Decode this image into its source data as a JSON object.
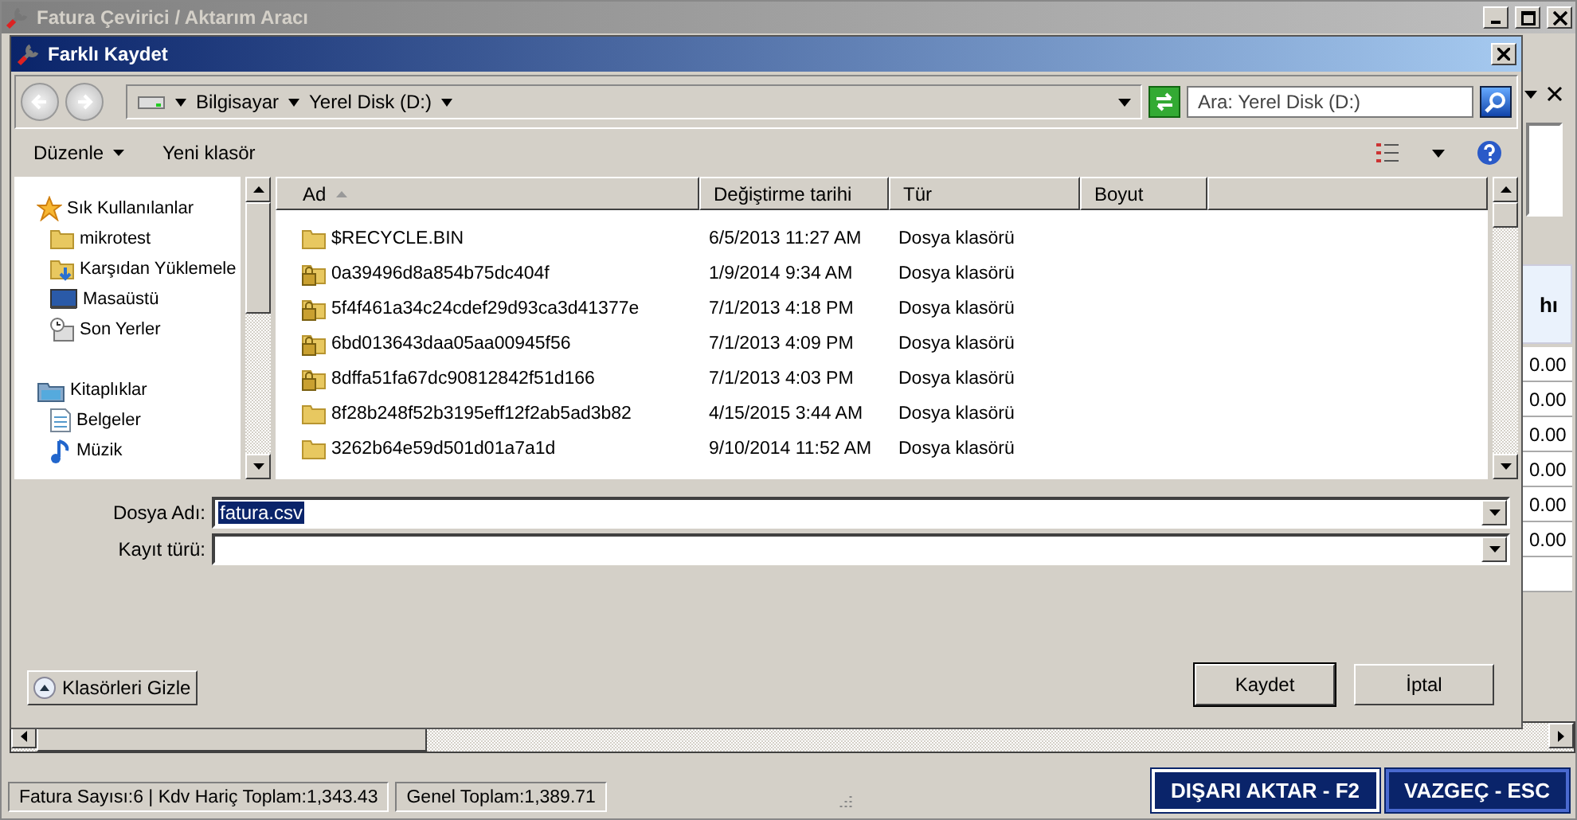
{
  "app": {
    "title": "Fatura Çevirici / Aktarım Aracı",
    "table_header_fragment": "hı",
    "table_cells": [
      "0.00",
      "0.00",
      "0.00",
      "0.00",
      "0.00",
      "0.00"
    ],
    "status_bar": [
      "Fatura Sayısı:6 | Kdv Hariç Toplam:1,343.43",
      "Genel Toplam:1,389.71"
    ],
    "buttons": [
      "DIŞARI AKTAR - F2",
      "VAZGEÇ - ESC"
    ]
  },
  "dialog": {
    "title": "Farklı Kaydet",
    "breadcrumb": [
      "Bilgisayar",
      "Yerel Disk (D:)"
    ],
    "search": {
      "placeholder": "Ara: Yerel Disk (D:)"
    },
    "toolbar": [
      "Düzenle",
      "Yeni klasör"
    ],
    "nav_tree": [
      {
        "label": "Sık Kullanılanlar",
        "kind": "favorites",
        "children": [
          {
            "label": "mikrotest",
            "kind": "folder"
          },
          {
            "label": "Karşıdan Yüklemele",
            "kind": "downloads"
          },
          {
            "label": "Masaüstü",
            "kind": "desktop"
          },
          {
            "label": "Son Yerler",
            "kind": "recent"
          }
        ]
      },
      {
        "label": "Kitaplıklar",
        "kind": "libraries",
        "children": [
          {
            "label": "Belgeler",
            "kind": "documents"
          },
          {
            "label": "Müzik",
            "kind": "music"
          }
        ]
      }
    ],
    "columns": [
      "Ad",
      "Değiştirme tarihi",
      "Tür",
      "Boyut"
    ],
    "files": [
      {
        "name": "$RECYCLE.BIN",
        "modified": "6/5/2013 11:27 AM",
        "type": "Dosya klasörü",
        "locked": false
      },
      {
        "name": "0a39496d8a854b75dc404f",
        "modified": "1/9/2014 9:34 AM",
        "type": "Dosya klasörü",
        "locked": true
      },
      {
        "name": "5f4f461a34c24cdef29d93ca3d41377e",
        "modified": "7/1/2013 4:18 PM",
        "type": "Dosya klasörü",
        "locked": true
      },
      {
        "name": "6bd013643daa05aa00945f56",
        "modified": "7/1/2013 4:09 PM",
        "type": "Dosya klasörü",
        "locked": true
      },
      {
        "name": "8dffa51fa67dc90812842f51d166",
        "modified": "7/1/2013 4:03 PM",
        "type": "Dosya klasörü",
        "locked": true
      },
      {
        "name": "8f28b248f52b3195eff12f2ab5ad3b82",
        "modified": "4/15/2015 3:44 AM",
        "type": "Dosya klasörü",
        "locked": false
      },
      {
        "name": "3262b64e59d501d01a7a1d",
        "modified": "9/10/2014 11:52 AM",
        "type": "Dosya klasörü",
        "locked": false
      }
    ],
    "fields": [
      {
        "label": "Dosya Adı:",
        "value": "fatura.csv",
        "selected": true
      },
      {
        "label": "Kayıt türü:",
        "selected": false
      }
    ],
    "hide_folders_button": "Klasörleri Gizle",
    "buttons": [
      "Kaydet",
      "İptal"
    ]
  }
}
